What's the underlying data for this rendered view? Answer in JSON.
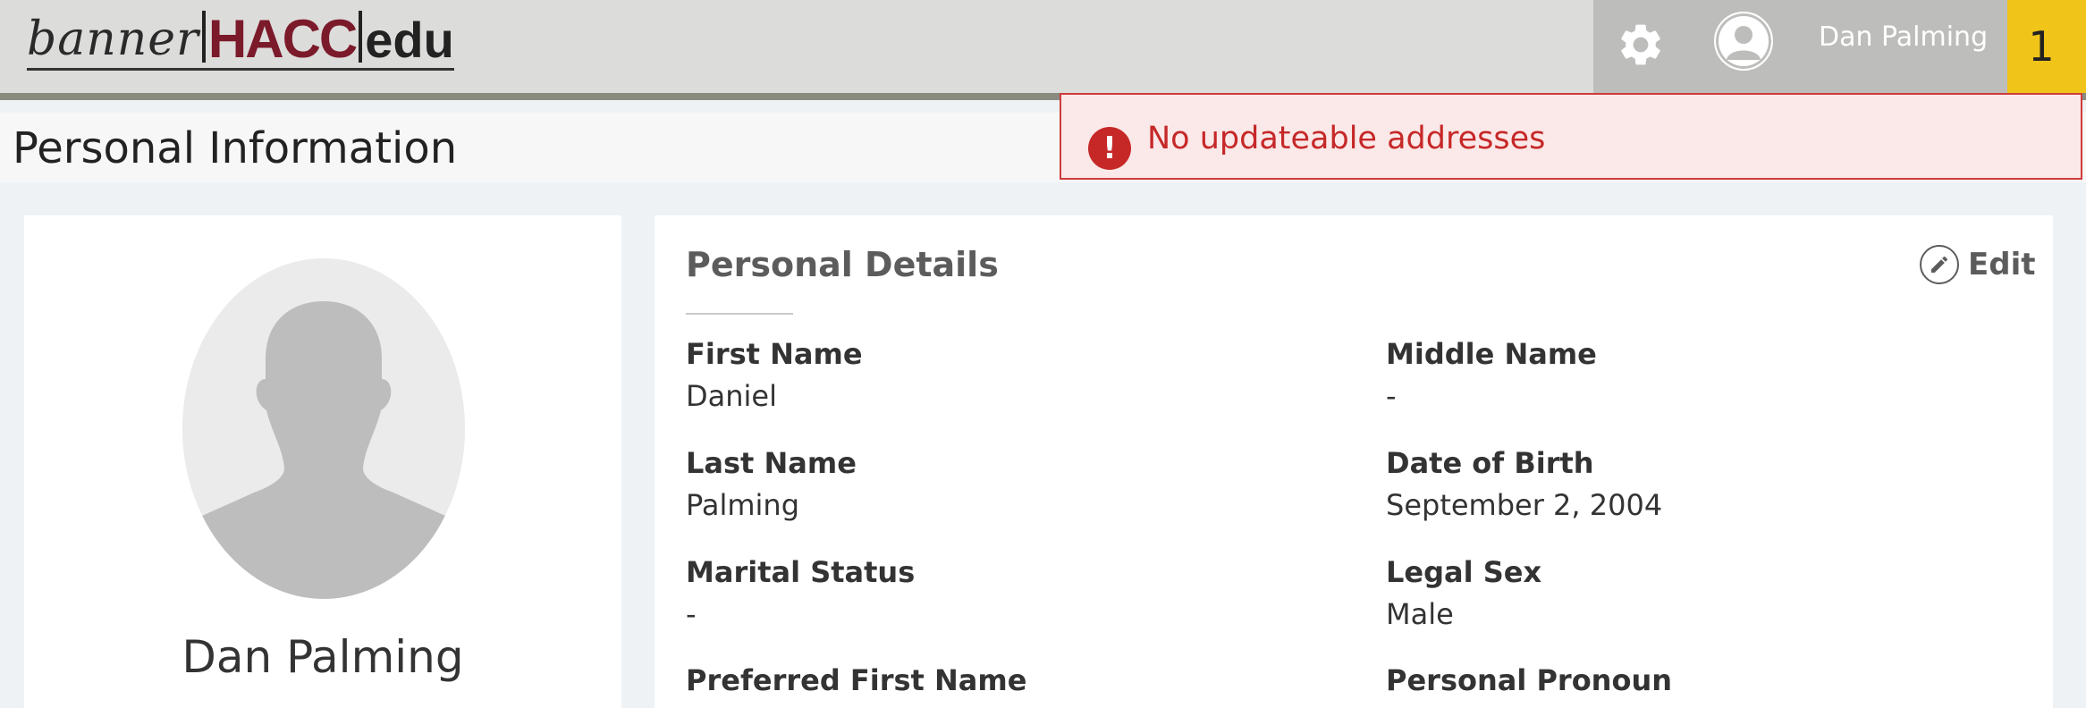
{
  "header": {
    "logo": {
      "part1": "banner",
      "part2": "HACC",
      "part3": "edu"
    },
    "user_name": "Dan Palming",
    "notification_count": "1",
    "icons": {
      "settings": "gear-icon",
      "user": "user-avatar-icon"
    }
  },
  "page": {
    "title": "Personal Information"
  },
  "alert": {
    "text": "No updateable addresses",
    "icon": "error-icon"
  },
  "profile": {
    "name": "Dan Palming"
  },
  "personal_details": {
    "title": "Personal Details",
    "edit_label": "Edit",
    "fields": [
      {
        "label": "First Name",
        "value": "Daniel"
      },
      {
        "label": "Middle Name",
        "value": "-"
      },
      {
        "label": "Last Name",
        "value": "Palming"
      },
      {
        "label": "Date of Birth",
        "value": "September 2, 2004"
      },
      {
        "label": "Marital Status",
        "value": "-"
      },
      {
        "label": "Legal Sex",
        "value": "Male"
      },
      {
        "label": "Preferred First Name",
        "value": ""
      },
      {
        "label": "Personal Pronoun",
        "value": ""
      }
    ]
  }
}
